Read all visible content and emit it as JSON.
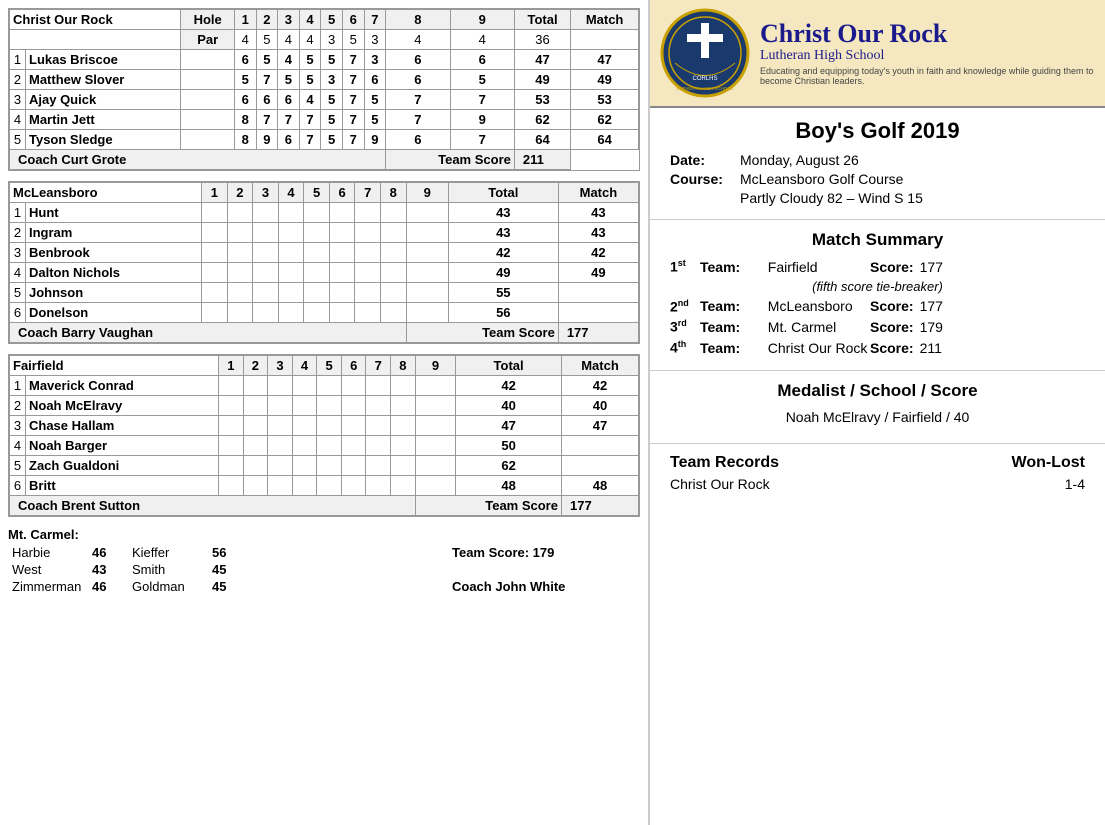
{
  "left": {
    "team1": {
      "name": "Christ Our Rock",
      "holes": [
        "Hole",
        "1",
        "2",
        "3",
        "4",
        "5",
        "6",
        "7",
        "8",
        "9",
        "Total",
        "Match"
      ],
      "par": [
        "Par",
        "4",
        "5",
        "4",
        "4",
        "3",
        "5",
        "3",
        "4",
        "4",
        "36",
        ""
      ],
      "players": [
        {
          "num": "1",
          "name": "Lukas Briscoe",
          "scores": [
            "6",
            "5",
            "4",
            "5",
            "5",
            "7",
            "3",
            "6",
            "6"
          ],
          "total": "47",
          "match": "47"
        },
        {
          "num": "2",
          "name": "Matthew Slover",
          "scores": [
            "5",
            "7",
            "5",
            "5",
            "3",
            "7",
            "6",
            "6",
            "5"
          ],
          "total": "49",
          "match": "49"
        },
        {
          "num": "3",
          "name": "Ajay Quick",
          "scores": [
            "6",
            "6",
            "6",
            "4",
            "5",
            "7",
            "5",
            "7",
            "7"
          ],
          "total": "53",
          "match": "53"
        },
        {
          "num": "4",
          "name": "Martin Jett",
          "scores": [
            "8",
            "7",
            "7",
            "7",
            "5",
            "7",
            "5",
            "7",
            "9"
          ],
          "total": "62",
          "match": "62"
        },
        {
          "num": "5",
          "name": "Tyson Sledge",
          "scores": [
            "8",
            "9",
            "6",
            "7",
            "5",
            "7",
            "9",
            "6",
            "7"
          ],
          "total": "64",
          "match": "64"
        }
      ],
      "coach": "Coach Curt Grote",
      "team_score_label": "Team Score",
      "team_score": "211"
    },
    "team2": {
      "name": "McLeansboro",
      "holes": [
        "",
        "1",
        "2",
        "3",
        "4",
        "5",
        "6",
        "7",
        "8",
        "9",
        "Total",
        "Match"
      ],
      "players": [
        {
          "num": "1",
          "name": "Hunt",
          "scores": [
            "",
            "",
            "",
            "",
            "",
            "",
            "",
            "",
            ""
          ],
          "total": "43",
          "match": "43"
        },
        {
          "num": "2",
          "name": "Ingram",
          "scores": [
            "",
            "",
            "",
            "",
            "",
            "",
            "",
            "",
            ""
          ],
          "total": "43",
          "match": "43"
        },
        {
          "num": "3",
          "name": "Benbrook",
          "scores": [
            "",
            "",
            "",
            "",
            "",
            "",
            "",
            "",
            ""
          ],
          "total": "42",
          "match": "42"
        },
        {
          "num": "4",
          "name": "Dalton Nichols",
          "scores": [
            "",
            "",
            "",
            "",
            "",
            "",
            "",
            "",
            ""
          ],
          "total": "49",
          "match": "49"
        },
        {
          "num": "5",
          "name": "Johnson",
          "scores": [
            "",
            "",
            "",
            "",
            "",
            "",
            "",
            "",
            ""
          ],
          "total": "55",
          "match": ""
        },
        {
          "num": "6",
          "name": "Donelson",
          "scores": [
            "",
            "",
            "",
            "",
            "",
            "",
            "",
            "",
            ""
          ],
          "total": "56",
          "match": ""
        }
      ],
      "coach": "Coach Barry Vaughan",
      "team_score_label": "Team Score",
      "team_score": "177"
    },
    "team3": {
      "name": "Fairfield",
      "holes": [
        "",
        "1",
        "2",
        "3",
        "4",
        "5",
        "6",
        "7",
        "8",
        "9",
        "Total",
        "Match"
      ],
      "players": [
        {
          "num": "1",
          "name": "Maverick Conrad",
          "scores": [
            "",
            "",
            "",
            "",
            "",
            "",
            "",
            "",
            ""
          ],
          "total": "42",
          "match": "42"
        },
        {
          "num": "2",
          "name": "Noah McElravy",
          "scores": [
            "",
            "",
            "",
            "",
            "",
            "",
            "",
            "",
            ""
          ],
          "total": "40",
          "match": "40"
        },
        {
          "num": "3",
          "name": "Chase Hallam",
          "scores": [
            "",
            "",
            "",
            "",
            "",
            "",
            "",
            "",
            ""
          ],
          "total": "47",
          "match": "47"
        },
        {
          "num": "4",
          "name": "Noah Barger",
          "scores": [
            "",
            "",
            "",
            "",
            "",
            "",
            "",
            "",
            ""
          ],
          "total": "50",
          "match": ""
        },
        {
          "num": "5",
          "name": "Zach Gualdoni",
          "scores": [
            "",
            "",
            "",
            "",
            "",
            "",
            "",
            "",
            ""
          ],
          "total": "62",
          "match": ""
        },
        {
          "num": "6",
          "name": "Britt",
          "scores": [
            "",
            "",
            "",
            "",
            "",
            "",
            "",
            "",
            ""
          ],
          "total": "48",
          "match": "48"
        }
      ],
      "coach": "Coach Brent Sutton",
      "team_score_label": "Team Score",
      "team_score": "177"
    },
    "mt_carmel": {
      "title": "Mt. Carmel:",
      "col1": [
        {
          "name": "Harbie",
          "score": "46"
        },
        {
          "name": "West",
          "score": "43"
        },
        {
          "name": "Zimmerman",
          "score": "46"
        }
      ],
      "col2": [
        {
          "name": "Kieffer",
          "score": "56"
        },
        {
          "name": "Smith",
          "score": "45"
        },
        {
          "name": "Goldman",
          "score": "45"
        }
      ],
      "team_score": "Team Score: 179",
      "coach": "Coach John White"
    }
  },
  "right": {
    "banner": {
      "school_name1": "Christ Our Rock",
      "school_name2": "Lutheran High School",
      "tagline": "Educating and equipping today's youth in faith and knowledge while guiding them to become Christian leaders."
    },
    "event": {
      "title": "Boy's Golf  2019",
      "date_label": "Date:",
      "date_value": "Monday, August 26",
      "course_label": "Course:",
      "course_value": "McLeansboro Golf Course",
      "weather": "Partly Cloudy 82 – Wind S 15"
    },
    "match_summary": {
      "title": "Match Summary",
      "teams": [
        {
          "place": "1",
          "place_sup": "st",
          "team_label": "Team:",
          "team_name": "Fairfield",
          "score_label": "Score:",
          "score": "177"
        },
        {
          "tiebreaker": "(fifth score tie-breaker)"
        },
        {
          "place": "2",
          "place_sup": "nd",
          "team_label": "Team:",
          "team_name": "McLeansboro",
          "score_label": "Score:",
          "score": "177"
        },
        {
          "place": "3",
          "place_sup": "rd",
          "team_label": "Team:",
          "team_name": "Mt. Carmel",
          "score_label": "Score:",
          "score": "179"
        },
        {
          "place": "4",
          "place_sup": "th",
          "team_label": "Team:",
          "team_name": "Christ Our Rock",
          "score_label": "Score:",
          "score": "211"
        }
      ]
    },
    "medalist": {
      "title": "Medalist / School / Score",
      "value": "Noah McElravy / Fairfield / 40"
    },
    "records": {
      "header1": "Team Records",
      "header2": "Won-Lost",
      "rows": [
        {
          "team": "Christ Our Rock",
          "record": "1-4"
        }
      ]
    }
  }
}
